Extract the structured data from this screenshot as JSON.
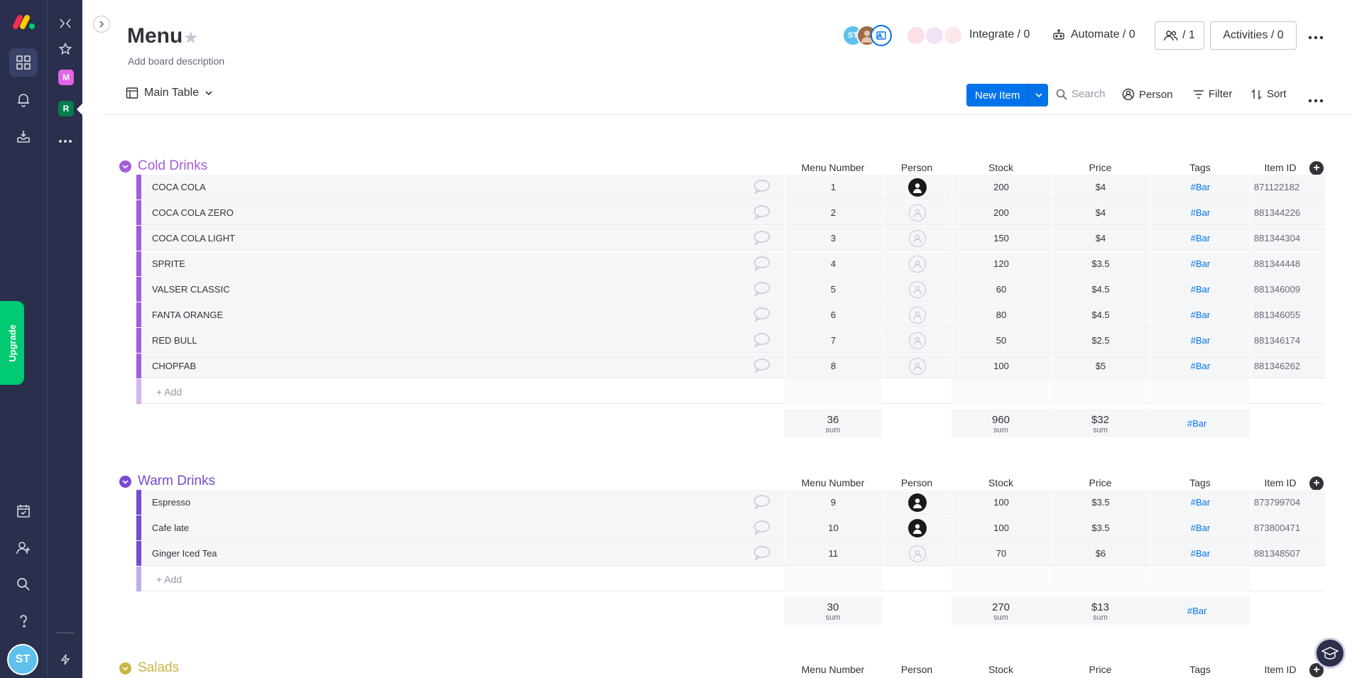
{
  "board": {
    "title": "Menu",
    "description": "Add board description"
  },
  "rail2": {
    "ws_m": "M",
    "ws_r": "R"
  },
  "rail": {
    "upgrade_label": "Upgrade",
    "user_initials": "ST"
  },
  "header": {
    "avatar_initials": "ST",
    "integrate_label": "Integrate / 0",
    "automate_label": "Automate / 0",
    "members_label": "/ 1",
    "activities_label": "Activities / 0"
  },
  "toolbar": {
    "view_label": "Main Table",
    "new_item_label": "New Item",
    "search_placeholder": "Search",
    "person_label": "Person",
    "filter_label": "Filter",
    "sort_label": "Sort"
  },
  "columns": [
    "Menu Number",
    "Person",
    "Stock",
    "Price",
    "Tags",
    "Item ID"
  ],
  "add_label": "+ Add",
  "sum_label": "sum",
  "groups": [
    {
      "title": "Cold Drinks",
      "color": "#a25ddc",
      "rows": [
        {
          "name": "COCA COLA",
          "number": "1",
          "person": "filled",
          "stock": "200",
          "price": "$4",
          "tag": "#Bar",
          "id": "871122182"
        },
        {
          "name": "COCA COLA ZERO",
          "number": "2",
          "person": "empty",
          "stock": "200",
          "price": "$4",
          "tag": "#Bar",
          "id": "881344226"
        },
        {
          "name": "COCA COLA LIGHT",
          "number": "3",
          "person": "empty",
          "stock": "150",
          "price": "$4",
          "tag": "#Bar",
          "id": "881344304"
        },
        {
          "name": "SPRITE",
          "number": "4",
          "person": "empty",
          "stock": "120",
          "price": "$3.5",
          "tag": "#Bar",
          "id": "881344448"
        },
        {
          "name": "VALSER CLASSIC",
          "number": "5",
          "person": "empty",
          "stock": "60",
          "price": "$4.5",
          "tag": "#Bar",
          "id": "881346009"
        },
        {
          "name": "FANTA ORANGE",
          "number": "6",
          "person": "empty",
          "stock": "80",
          "price": "$4.5",
          "tag": "#Bar",
          "id": "881346055"
        },
        {
          "name": "RED BULL",
          "number": "7",
          "person": "empty",
          "stock": "50",
          "price": "$2.5",
          "tag": "#Bar",
          "id": "881346174"
        },
        {
          "name": "CHOPFAB",
          "number": "8",
          "person": "empty",
          "stock": "100",
          "price": "$5",
          "tag": "#Bar",
          "id": "881346262"
        }
      ],
      "sums": {
        "number": "36",
        "stock": "960",
        "price": "$32",
        "tag": "#Bar"
      }
    },
    {
      "title": "Warm Drinks",
      "color": "#784bd1",
      "rows": [
        {
          "name": "Espresso",
          "number": "9",
          "person": "filled",
          "stock": "100",
          "price": "$3.5",
          "tag": "#Bar",
          "id": "873799704"
        },
        {
          "name": "Cafe late",
          "number": "10",
          "person": "filled",
          "stock": "100",
          "price": "$3.5",
          "tag": "#Bar",
          "id": "873800471"
        },
        {
          "name": "Ginger Iced Tea",
          "number": "11",
          "person": "empty",
          "stock": "70",
          "price": "$6",
          "tag": "#Bar",
          "id": "881348507"
        }
      ],
      "sums": {
        "number": "30",
        "stock": "270",
        "price": "$13",
        "tag": "#Bar"
      }
    },
    {
      "title": "Salads",
      "color": "#cab641",
      "rows": [],
      "sums": null
    }
  ]
}
